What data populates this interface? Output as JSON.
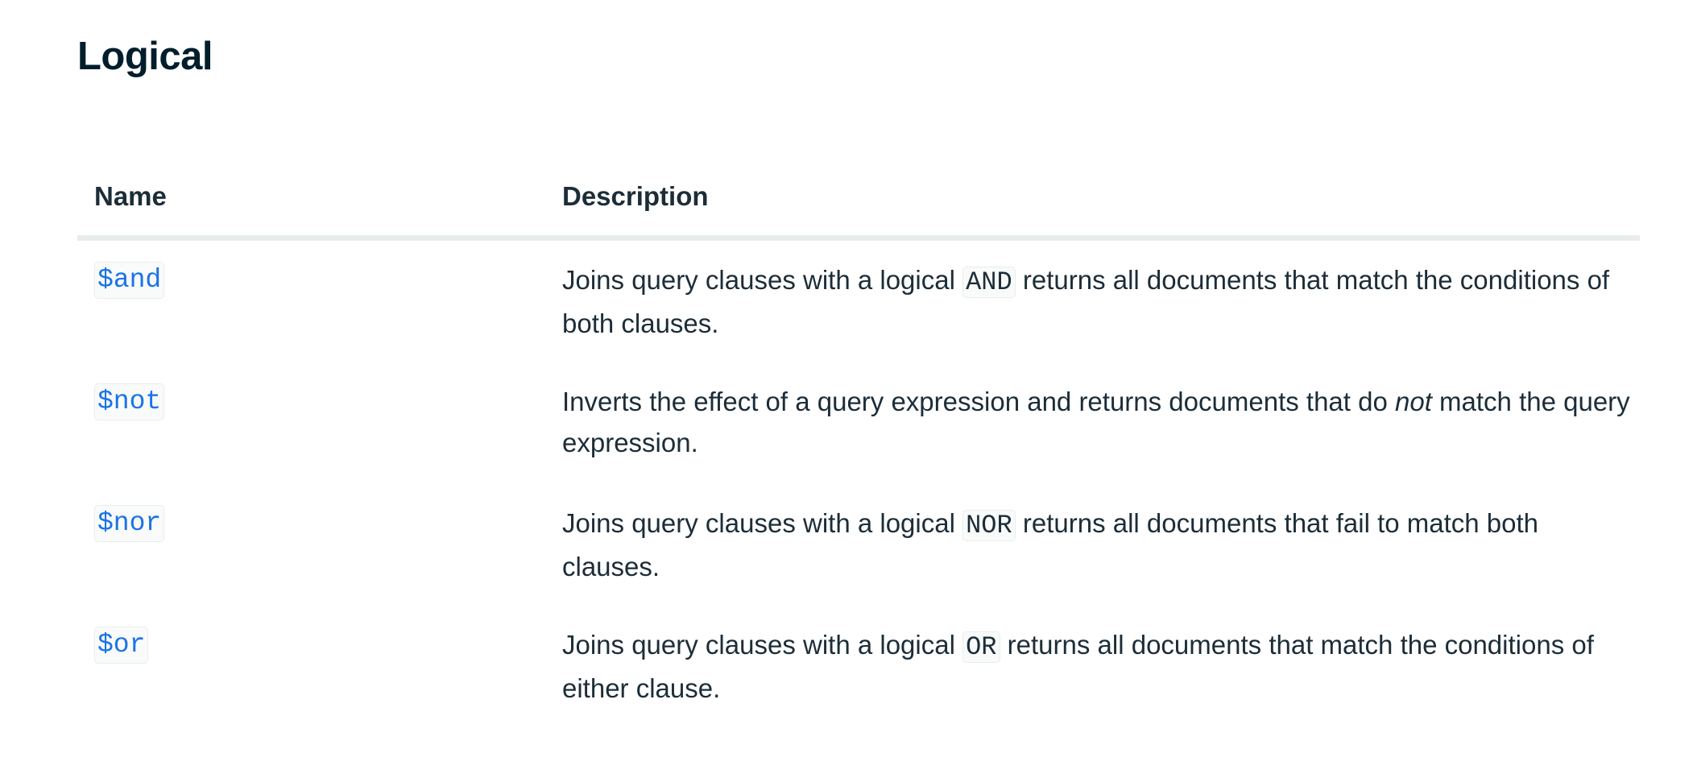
{
  "section": {
    "title": "Logical"
  },
  "table": {
    "headers": {
      "name": "Name",
      "description": "Description"
    },
    "rows": [
      {
        "name": "$and",
        "desc_before": "Joins query clauses with a logical ",
        "desc_code": "AND",
        "desc_after": " returns all documents that match the conditions of both clauses."
      },
      {
        "name": "$not",
        "desc_before": "Inverts the effect of a query expression and returns documents that do ",
        "desc_em": "not",
        "desc_after": " match the query expression."
      },
      {
        "name": "$nor",
        "desc_before": "Joins query clauses with a logical ",
        "desc_code": "NOR",
        "desc_after": " returns all documents that fail to match both clauses."
      },
      {
        "name": "$or",
        "desc_before": "Joins query clauses with a logical ",
        "desc_code": "OR",
        "desc_after": " returns all documents that match the conditions of either clause."
      }
    ]
  },
  "colors": {
    "title_text": "#001e2b",
    "body_text": "#1c2d38",
    "link": "#1a73e8",
    "code_bg": "#f9fbfa",
    "code_border": "#e8edeb",
    "header_rule": "#e8edeb"
  }
}
